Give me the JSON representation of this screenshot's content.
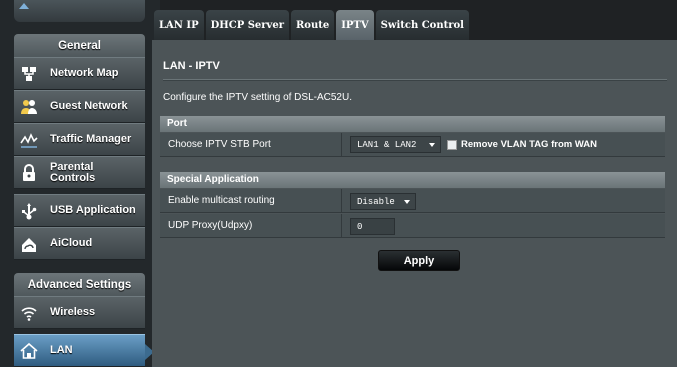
{
  "sidebar": {
    "general_header": "General",
    "advanced_header": "Advanced Settings",
    "items": [
      {
        "label": "Network Map",
        "icon": "network-map-icon"
      },
      {
        "label": "Guest Network",
        "icon": "guest-network-icon"
      },
      {
        "label": "Traffic Manager",
        "icon": "traffic-manager-icon"
      },
      {
        "label": "Parental Controls",
        "icon": "parental-controls-icon"
      },
      {
        "label": "USB Application",
        "icon": "usb-application-icon"
      },
      {
        "label": "AiCloud",
        "icon": "aicloud-icon"
      },
      {
        "label": "Wireless",
        "icon": "wireless-icon"
      },
      {
        "label": "LAN",
        "icon": "lan-icon",
        "active": true
      }
    ]
  },
  "tabs": [
    {
      "label": "LAN IP"
    },
    {
      "label": "DHCP Server"
    },
    {
      "label": "Route"
    },
    {
      "label": "IPTV",
      "active": true
    },
    {
      "label": "Switch Control"
    }
  ],
  "main": {
    "title": "LAN - IPTV",
    "description": "Configure the IPTV setting of DSL-AC52U.",
    "port_section": {
      "header": "Port",
      "stb_label": "Choose IPTV STB Port",
      "stb_value": "LAN1 & LAN2",
      "remove_vlan_label": "Remove VLAN TAG from WAN",
      "remove_vlan_checked": false
    },
    "special_section": {
      "header": "Special Application",
      "multicast_label": "Enable multicast routing",
      "multicast_value": "Disable",
      "udp_label": "UDP Proxy(Udpxy)",
      "udp_value": "0"
    },
    "apply_label": "Apply"
  },
  "colors": {
    "accent_blue": "#3c6b8f",
    "panel_bg": "#4c5457",
    "section_bg": "#7d878a",
    "sidebar_bg": "#23282b"
  }
}
